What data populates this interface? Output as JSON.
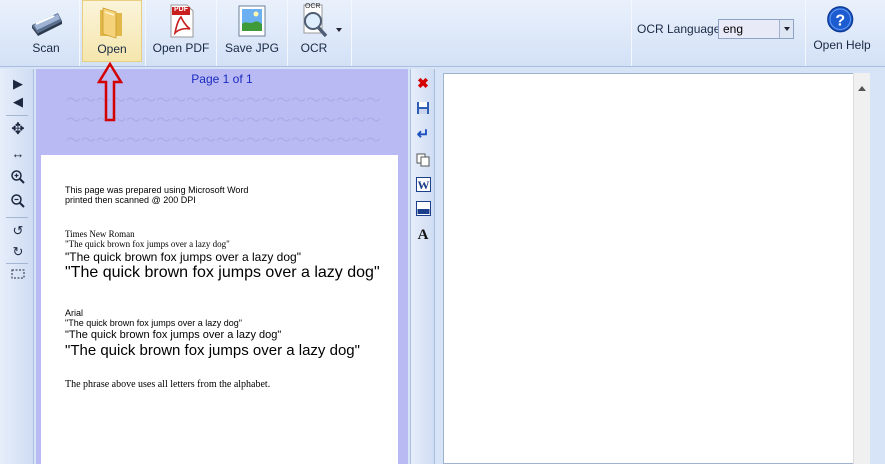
{
  "toolbar": {
    "scan_label": "Scan",
    "open_label": "Open",
    "open_pdf_label": "Open PDF",
    "save_jpg_label": "Save JPG",
    "ocr_label": "OCR",
    "ocr_icon_text": "OCR",
    "pdf_icon_text": "PDF",
    "ocr_language_label": "OCR Language:",
    "ocr_language_value": "eng",
    "help_label": "Open Help"
  },
  "document": {
    "page_indicator": "Page 1 of 1",
    "lines": {
      "l1": "This page was prepared using Microsoft Word",
      "l2": "printed then scanned @ 200 DPI",
      "l3": "Times New Roman",
      "l4": "\"The quick brown fox jumps over a lazy dog\"",
      "l5": "\"The quick brown fox jumps over a lazy dog\"",
      "l6": "\"The quick brown fox jumps over a lazy dog\"",
      "l7": "Arial",
      "l8": "\"The quick brown fox jumps over a lazy dog\"",
      "l9": "\"The quick brown fox jumps over a lazy dog\"",
      "l10": "\"The quick brown fox jumps over a lazy dog\"",
      "l11": "The phrase above uses all letters from the alphabet."
    }
  },
  "colors": {
    "accent_red": "#d40000",
    "doc_bg": "#b9b9f4"
  }
}
